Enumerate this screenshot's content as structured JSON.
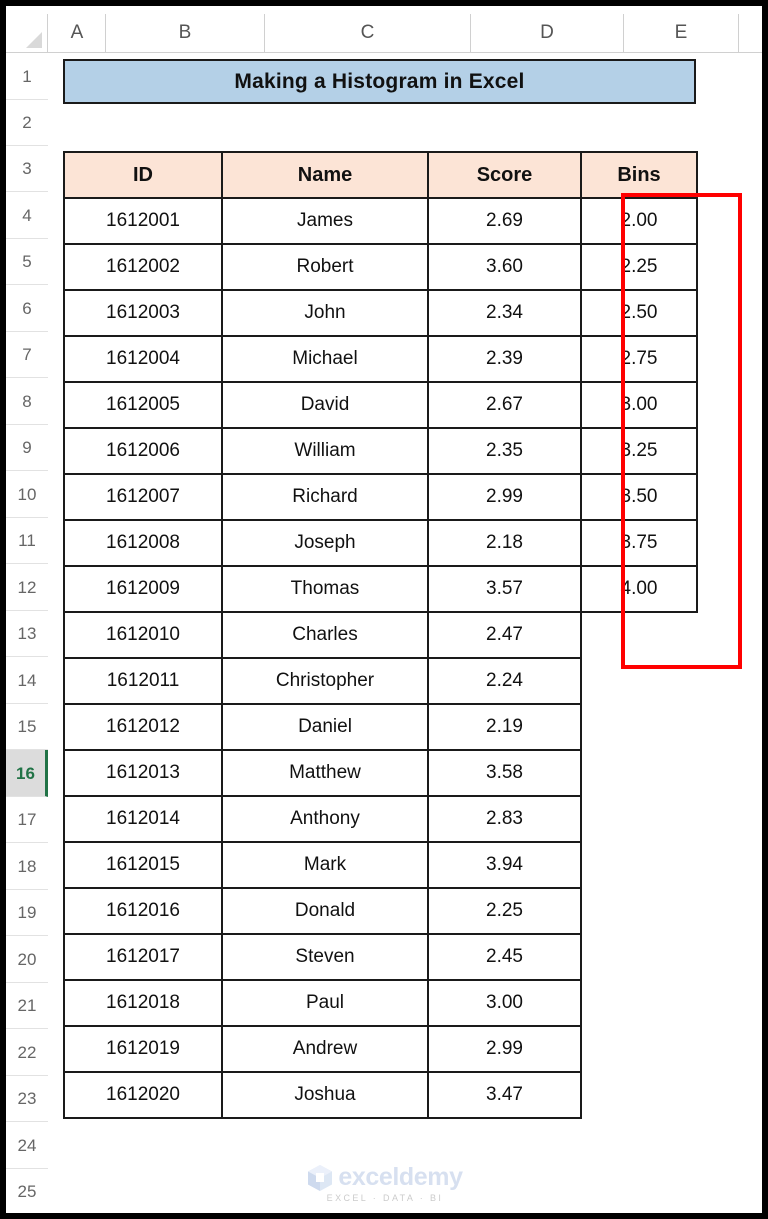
{
  "app": {
    "name": "Microsoft Excel",
    "corner_icon": "select-all-triangle-icon"
  },
  "columns": {
    "headers": [
      "A",
      "B",
      "C",
      "D",
      "E"
    ],
    "widths": [
      57,
      159,
      206,
      153,
      115
    ]
  },
  "rows": {
    "numbers": [
      "1",
      "2",
      "3",
      "4",
      "5",
      "6",
      "7",
      "8",
      "9",
      "10",
      "11",
      "12",
      "13",
      "14",
      "15",
      "16",
      "17",
      "18",
      "19",
      "20",
      "21",
      "22",
      "23",
      "24",
      "25"
    ],
    "selected": "16"
  },
  "title_banner": {
    "text": "Making a Histogram in Excel",
    "fill_color": "#b4d0e7",
    "border_color": "#1a1a1a",
    "cell": "B2"
  },
  "table": {
    "headers": [
      "ID",
      "Name",
      "Score",
      "Bins"
    ],
    "header_fill": "#fce4d6",
    "border_color": "#1a1a1a",
    "rows": [
      {
        "id": "1612001",
        "name": "James",
        "score": "2.69",
        "bin": "2.00"
      },
      {
        "id": "1612002",
        "name": "Robert",
        "score": "3.60",
        "bin": "2.25"
      },
      {
        "id": "1612003",
        "name": "John",
        "score": "2.34",
        "bin": "2.50"
      },
      {
        "id": "1612004",
        "name": "Michael",
        "score": "2.39",
        "bin": "2.75"
      },
      {
        "id": "1612005",
        "name": "David",
        "score": "2.67",
        "bin": "3.00"
      },
      {
        "id": "1612006",
        "name": "William",
        "score": "2.35",
        "bin": "3.25"
      },
      {
        "id": "1612007",
        "name": "Richard",
        "score": "2.99",
        "bin": "3.50"
      },
      {
        "id": "1612008",
        "name": "Joseph",
        "score": "2.18",
        "bin": "3.75"
      },
      {
        "id": "1612009",
        "name": "Thomas",
        "score": "3.57",
        "bin": "4.00"
      },
      {
        "id": "1612010",
        "name": "Charles",
        "score": "2.47",
        "bin": ""
      },
      {
        "id": "1612011",
        "name": "Christopher",
        "score": "2.24",
        "bin": ""
      },
      {
        "id": "1612012",
        "name": "Daniel",
        "score": "2.19",
        "bin": ""
      },
      {
        "id": "1612013",
        "name": "Matthew",
        "score": "3.58",
        "bin": ""
      },
      {
        "id": "1612014",
        "name": "Anthony",
        "score": "2.83",
        "bin": ""
      },
      {
        "id": "1612015",
        "name": "Mark",
        "score": "3.94",
        "bin": ""
      },
      {
        "id": "1612016",
        "name": "Donald",
        "score": "2.25",
        "bin": ""
      },
      {
        "id": "1612017",
        "name": "Steven",
        "score": "2.45",
        "bin": ""
      },
      {
        "id": "1612018",
        "name": "Paul",
        "score": "3.00",
        "bin": ""
      },
      {
        "id": "1612019",
        "name": "Andrew",
        "score": "2.99",
        "bin": ""
      },
      {
        "id": "1612020",
        "name": "Joshua",
        "score": "3.47",
        "bin": ""
      }
    ]
  },
  "highlight": {
    "color": "#ff0000",
    "target_column": "Bins",
    "cell_range": "E4:E13"
  },
  "watermark": {
    "name": "exceldemy",
    "tagline": "EXCEL · DATA · BI",
    "icon": "cube-logo-icon",
    "color": "#d5dff0"
  }
}
